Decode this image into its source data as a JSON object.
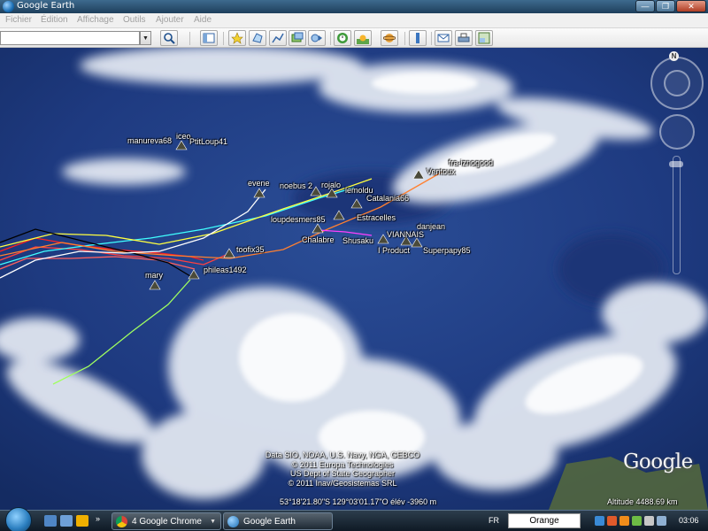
{
  "window": {
    "title": "Google Earth"
  },
  "menu": [
    "Fichier",
    "Édition",
    "Affichage",
    "Outils",
    "Ajouter",
    "Aide"
  ],
  "toolbar": {
    "search_value": "",
    "search_icon": "magnifier-icon",
    "buttons": [
      "sidebar-toggle-icon",
      "placemark-icon",
      "polygon-icon",
      "path-icon",
      "overlay-icon",
      "tour-icon",
      "historical-imagery-icon",
      "sunlight-icon",
      "sky-planet-icon",
      "ruler-icon",
      "email-icon",
      "print-icon",
      "maps-icon"
    ]
  },
  "map": {
    "boats": [
      {
        "label": "manureva68"
      },
      {
        "label": "iceo"
      },
      {
        "label": "PtitLoup41"
      },
      {
        "label": "evene"
      },
      {
        "label": "noebus 2"
      },
      {
        "label": "rojalo"
      },
      {
        "label": "lemoldu"
      },
      {
        "label": "fra-iznogood"
      },
      {
        "label": "Ventoux"
      },
      {
        "label": "Catalania66"
      },
      {
        "label": "Estracelles"
      },
      {
        "label": "loupdesmers85"
      },
      {
        "label": "danjean"
      },
      {
        "label": "VIANNAIS"
      },
      {
        "label": "Chalabre"
      },
      {
        "label": "Shusaku"
      },
      {
        "label": "I Product"
      },
      {
        "label": "Superpapy85"
      },
      {
        "label": "toofix35"
      },
      {
        "label": "phileas1492"
      },
      {
        "label": "mary"
      }
    ],
    "track_colors": [
      "#ff2020",
      "#ffff40",
      "#40ffff",
      "#ffffff",
      "#ff8030",
      "#000000",
      "#ff40ff",
      "#a0ff60"
    ],
    "attribution": [
      "Data SIO, NOAA, U.S. Navy, NGA, GEBCO",
      "© 2011 Europa Technologies",
      "US Dept of State Geographer",
      "© 2011 Inav/Geosistemas SRL"
    ],
    "status_coords": "53°18'21.80\"S  129°03'01.17\"O  élév -3960 m",
    "altitude": "Altitude  4488.69 km",
    "logo": "Google",
    "north_label": "N"
  },
  "taskbar": {
    "tasks": [
      {
        "label": "4 Google Chrome",
        "icon": "chrome-icon"
      },
      {
        "label": "Google Earth",
        "icon": "google-earth-icon"
      }
    ],
    "language": "FR",
    "toolbar_text": "Orange",
    "clock": "03:06"
  }
}
